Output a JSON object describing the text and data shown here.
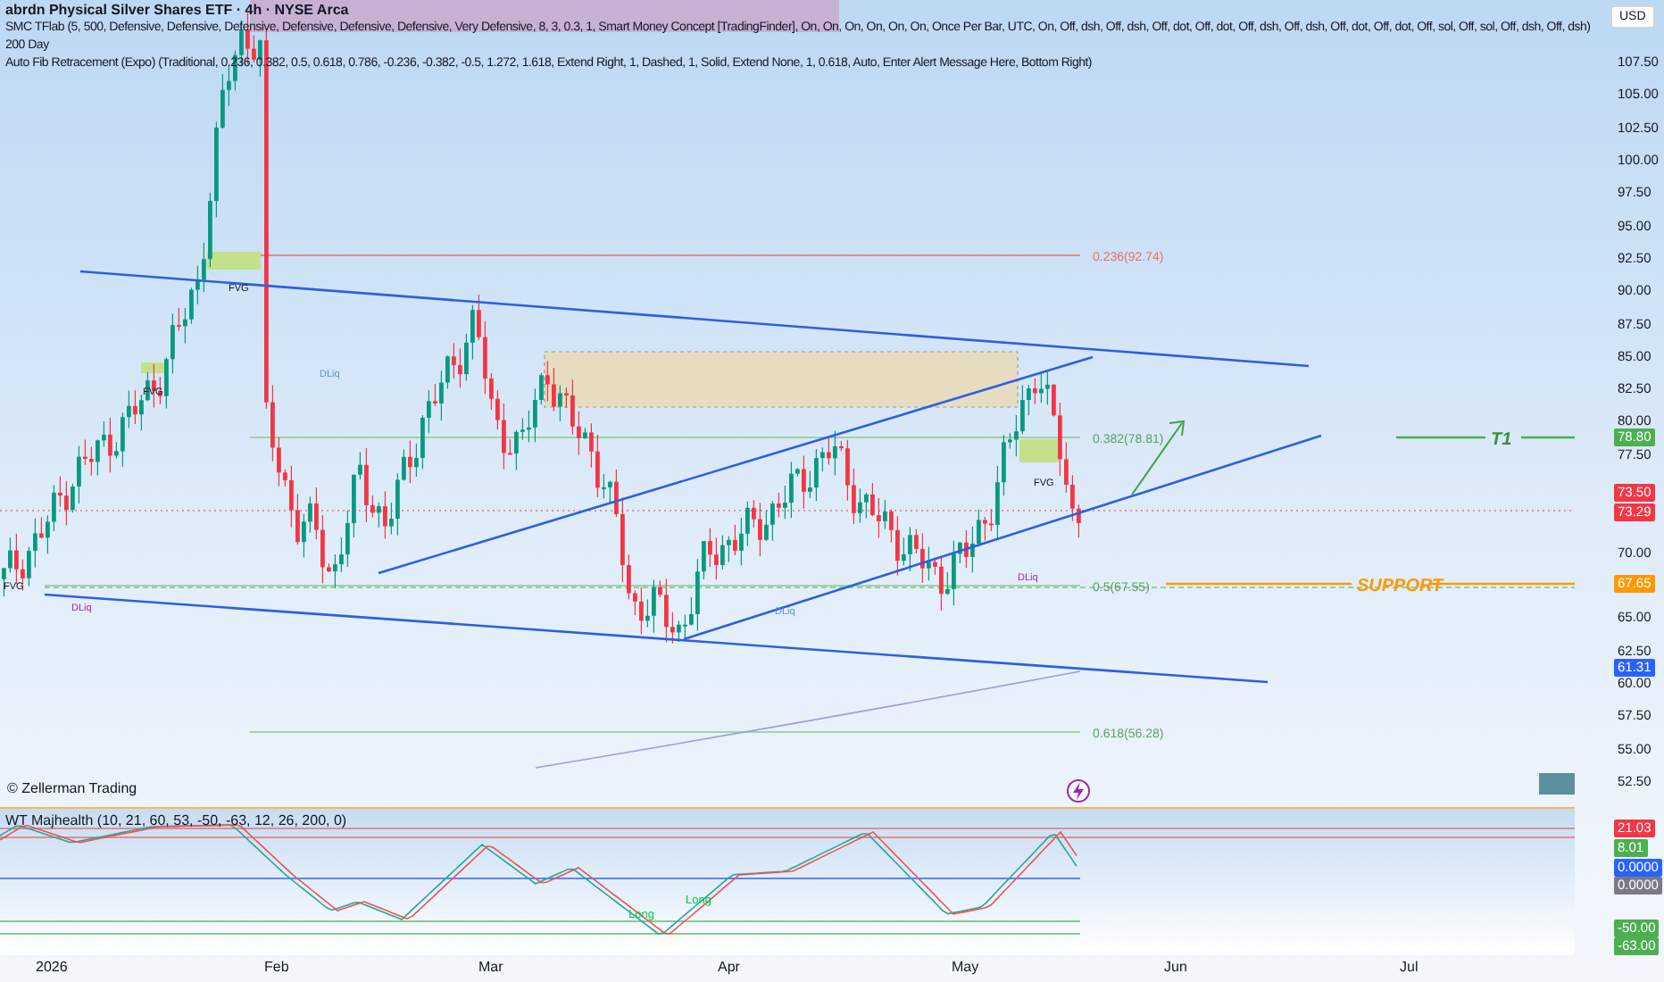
{
  "header": {
    "title": "abrdn Physical Silver Shares ETF · 4h · NYSE Arca",
    "indicators": [
      "SMC TFlab (5, 500, Defensive, Defensive, Defensive, Defensive, Defensive, Defensive, Very Defensive, 8, 3, 0.3, 1, Smart Money Concept [TradingFinder], On, On, On, On, On, On, Once Per Bar, UTC, On, Off, dsh, Off, dsh, Off, dot, Off, dot, Off, dsh, Off, dsh, Off, dot, Off, dot, Off, sol, Off, sol, Off, dsh, Off, dsh)",
      "200 Day",
      "Auto Fib Retracement (Expo) (Traditional, 0.236, 0.382, 0.5, 0.618, 0.786, -0.236, -0.382, -0.5, 1.272, 1.618, Extend Right, 1, Dashed, 1, Solid, Extend None, 1, 0.618, Auto, Enter Alert Message Here, Bottom Right)"
    ]
  },
  "currency_button": "USD",
  "price_axis": {
    "ticks": [
      "107.50",
      "105.00",
      "102.50",
      "100.00",
      "97.50",
      "95.00",
      "92.50",
      "90.00",
      "87.50",
      "85.00",
      "82.50",
      "80.00",
      "77.50",
      "70.00",
      "65.00",
      "62.50",
      "60.00",
      "57.50",
      "55.00",
      "52.50"
    ]
  },
  "price_badges": [
    {
      "label": "78.80",
      "color": "#4caf50"
    },
    {
      "label": "73.50",
      "color": "#f23645"
    },
    {
      "label": "73.29",
      "color": "#f23645"
    },
    {
      "label": "67.65",
      "color": "#ff9800"
    },
    {
      "label": "61.31",
      "color": "#2962ff"
    }
  ],
  "chart_labels": {
    "fib_levels": [
      "0.236(92.74)",
      "0.382(78.81)",
      "0.5(67.55)",
      "0.618(56.28)"
    ],
    "target": "T1",
    "support": "SUPPORT",
    "fvg_labels": [
      "FVG",
      "FVG",
      "FVG",
      "FVG"
    ],
    "dliq_labels": [
      "DLiq",
      "DLiq",
      "DLiq",
      "DLiq"
    ],
    "credit": "© Zellerman Trading"
  },
  "indicator": {
    "title": "WT Majhealth (10, 21, 60, 53, -50, -63, 12, 26, 200, 0)",
    "signals": [
      "Long",
      "Long"
    ],
    "badges": [
      {
        "label": "21.03",
        "color": "#f23645"
      },
      {
        "label": "8.01",
        "color": "#4caf50"
      },
      {
        "label": "0.0000",
        "color": "#2962ff"
      },
      {
        "label": "0.0000",
        "color": "#787b86"
      },
      {
        "label": "-50.00",
        "color": "#4caf50"
      },
      {
        "label": "-63.00",
        "color": "#4caf50"
      }
    ]
  },
  "time_axis": [
    "2026",
    "Feb",
    "Mar",
    "Apr",
    "May",
    "Jun",
    "Jul"
  ]
}
